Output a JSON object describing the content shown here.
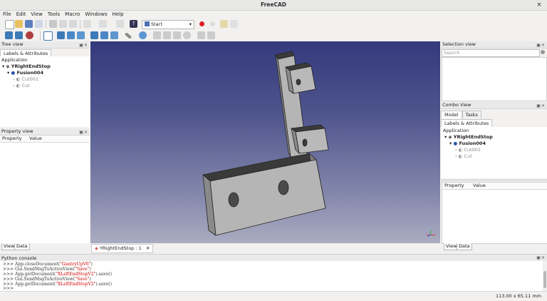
{
  "window": {
    "title": "FreeCAD",
    "close": "×"
  },
  "menu": [
    "File",
    "Edit",
    "View",
    "Tools",
    "Macro",
    "Windows",
    "Help"
  ],
  "toolbar": {
    "workbench": "Start"
  },
  "tree_view": {
    "title": "Tree view",
    "tab": "Labels & Attributes",
    "application": "Application",
    "items": [
      {
        "label": "YRightEndStop",
        "bold": true
      },
      {
        "label": "Fusion004",
        "bold": true
      },
      {
        "label": "Cut001",
        "bold": false
      },
      {
        "label": "Cut",
        "bold": false
      }
    ]
  },
  "property_view": {
    "title": "Property view",
    "col1": "Property",
    "col2": "Value",
    "tabs": [
      "View",
      "Data"
    ]
  },
  "viewport": {
    "tab_label": "YRightEndStop : 1"
  },
  "selection_view": {
    "title": "Selection view",
    "search_placeholder": "Search"
  },
  "combo_view": {
    "title": "Combo View",
    "tabs": [
      "Model",
      "Tasks"
    ],
    "subtab": "Labels & Attributes",
    "application": "Application",
    "items": [
      {
        "label": "YRightEndStop"
      },
      {
        "label": "Fusion004"
      },
      {
        "label": "Cut001"
      },
      {
        "label": "Cut"
      }
    ],
    "prop_col1": "Property",
    "prop_col2": "Value",
    "bottom_tabs": [
      "View",
      "Data"
    ]
  },
  "console": {
    "title": "Python console",
    "lines": [
      {
        "prompt": ">>>",
        "code": "App.closeDocument(",
        "str": "\"GantryUpV6\"",
        "tail": ")"
      },
      {
        "prompt": ">>>",
        "code": "Gui.SendMsgToActiveView(",
        "str": "\"Save\"",
        "tail": ")"
      },
      {
        "prompt": ">>>",
        "code": "App.getDocument(",
        "str": "\"XLeftEndStopV2\"",
        "tail": ").save()"
      },
      {
        "prompt": ">>>",
        "code": "Gui.SendMsgToActiveView(",
        "str": "\"Save\"",
        "tail": ")"
      },
      {
        "prompt": ">>>",
        "code": "App.getDocument(",
        "str": "\"XLeftEndStopV2\"",
        "tail": ").save()"
      },
      {
        "prompt": ">>>",
        "code": "",
        "str": "",
        "tail": ""
      }
    ]
  },
  "status": {
    "dimensions": "113.00 x 65.11 mm"
  }
}
